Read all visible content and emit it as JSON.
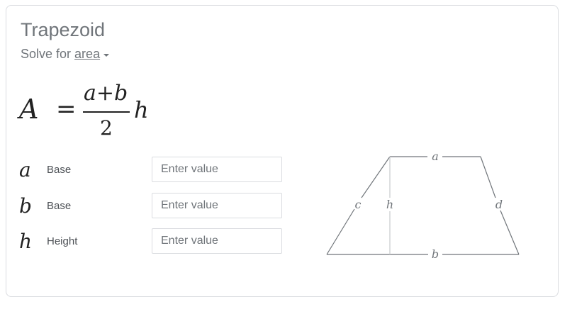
{
  "card": {
    "title": "Trapezoid",
    "solve_prefix": "Solve for",
    "solve_target": "area"
  },
  "formula": {
    "lhs": "A",
    "equals": "=",
    "num_a": "a",
    "num_plus": "+",
    "num_b": "b",
    "denominator": "2",
    "multiplier": "h"
  },
  "inputs": [
    {
      "symbol": "a",
      "label": "Base",
      "placeholder": "Enter value"
    },
    {
      "symbol": "b",
      "label": "Base",
      "placeholder": "Enter value"
    },
    {
      "symbol": "h",
      "label": "Height",
      "placeholder": "Enter value"
    }
  ],
  "diagram": {
    "top_label": "a",
    "bottom_label": "b",
    "left_label": "c",
    "right_label": "d",
    "height_label": "h"
  },
  "colors": {
    "title": "#70757a",
    "border": "#dadce0",
    "diagram_line": "#70757a"
  }
}
